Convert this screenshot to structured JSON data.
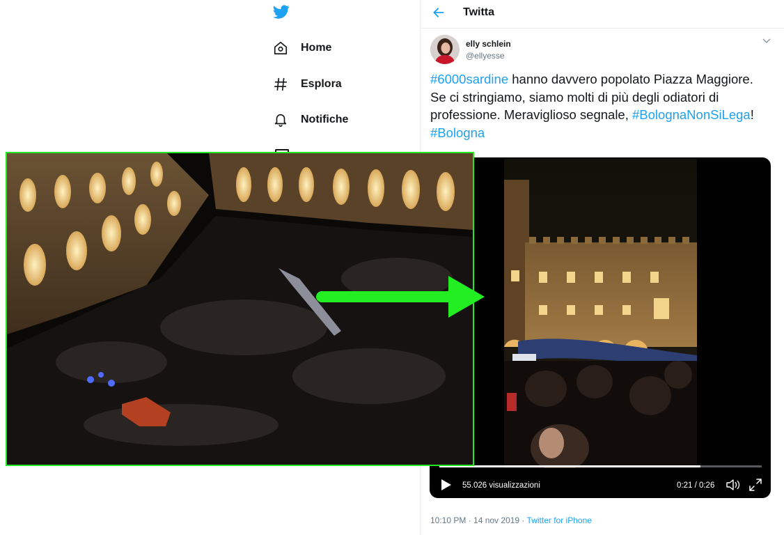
{
  "nav": {
    "items": [
      {
        "label": "Home",
        "icon": "home-icon"
      },
      {
        "label": "Esplora",
        "icon": "hashtag-icon"
      },
      {
        "label": "Notifiche",
        "icon": "bell-icon"
      }
    ]
  },
  "header": {
    "title": "Twitta"
  },
  "tweet": {
    "author_name": "elly schlein",
    "author_handle": "@ellyesse",
    "text": {
      "tag1": "#6000sardine",
      "part1": " hanno davvero popolato Piazza Maggiore. Se ci stringiamo, siamo molti di più degli odiatori di professione. Meraviglioso segnale, ",
      "tag2": "#BolognaNonSiLega",
      "part2": "! ",
      "tag3": "#Bologna"
    },
    "timestamp": "10:10 PM · 14 nov 2019 · ",
    "source": "Twitter for iPhone"
  },
  "video": {
    "views": "55.026 visualizzazioni",
    "time": "0:21 / 0:26",
    "progress": 0.81
  },
  "colors": {
    "accent": "#1da1f2",
    "overlay_border": "#22e822",
    "arrow": "#22ee22"
  }
}
